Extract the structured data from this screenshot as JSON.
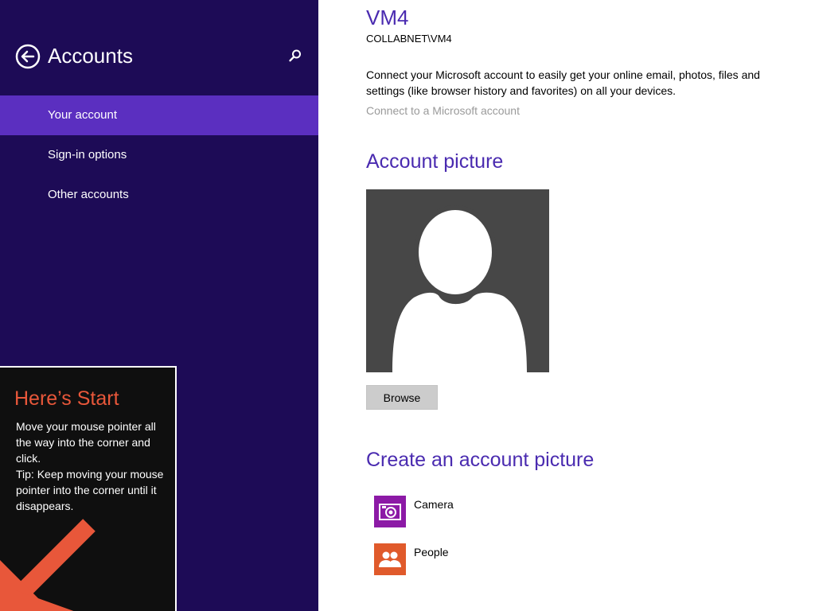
{
  "colors": {
    "left_pane_bg": "#1d0b56",
    "nav_selected_bg": "#5b2fc0",
    "accent_heading": "#4a2bb0",
    "tip_title": "#e8573a",
    "camera_tile": "#8c1aa6",
    "people_tile": "#e05a2b",
    "picture_bg": "#474747"
  },
  "left_pane": {
    "back_icon": "back-arrow-circle-icon",
    "title": "Accounts",
    "search_icon": "search-icon",
    "nav_items": [
      {
        "label": "Your account",
        "selected": true
      },
      {
        "label": "Sign-in options",
        "selected": false
      },
      {
        "label": "Other accounts",
        "selected": false
      }
    ]
  },
  "start_tip": {
    "title": "Here’s Start",
    "body": "Move your mouse pointer all the way into the corner and click.\nTip: Keep moving your mouse pointer into the corner until it disappears.",
    "arrow_icon": "arrow-down-left-icon"
  },
  "account": {
    "name": "VM4",
    "domain": "COLLABNET\\VM4",
    "connect_description": "Connect your Microsoft account to easily get your online email, photos, files and settings (like browser history and favorites) on all your devices.",
    "connect_link": "Connect to a Microsoft account"
  },
  "account_picture": {
    "heading": "Account picture",
    "picture_icon": "default-user-silhouette-icon",
    "browse_label": "Browse"
  },
  "create_picture": {
    "heading": "Create an account picture",
    "items": [
      {
        "label": "Camera",
        "icon": "camera-icon"
      },
      {
        "label": "People",
        "icon": "people-icon"
      }
    ]
  }
}
